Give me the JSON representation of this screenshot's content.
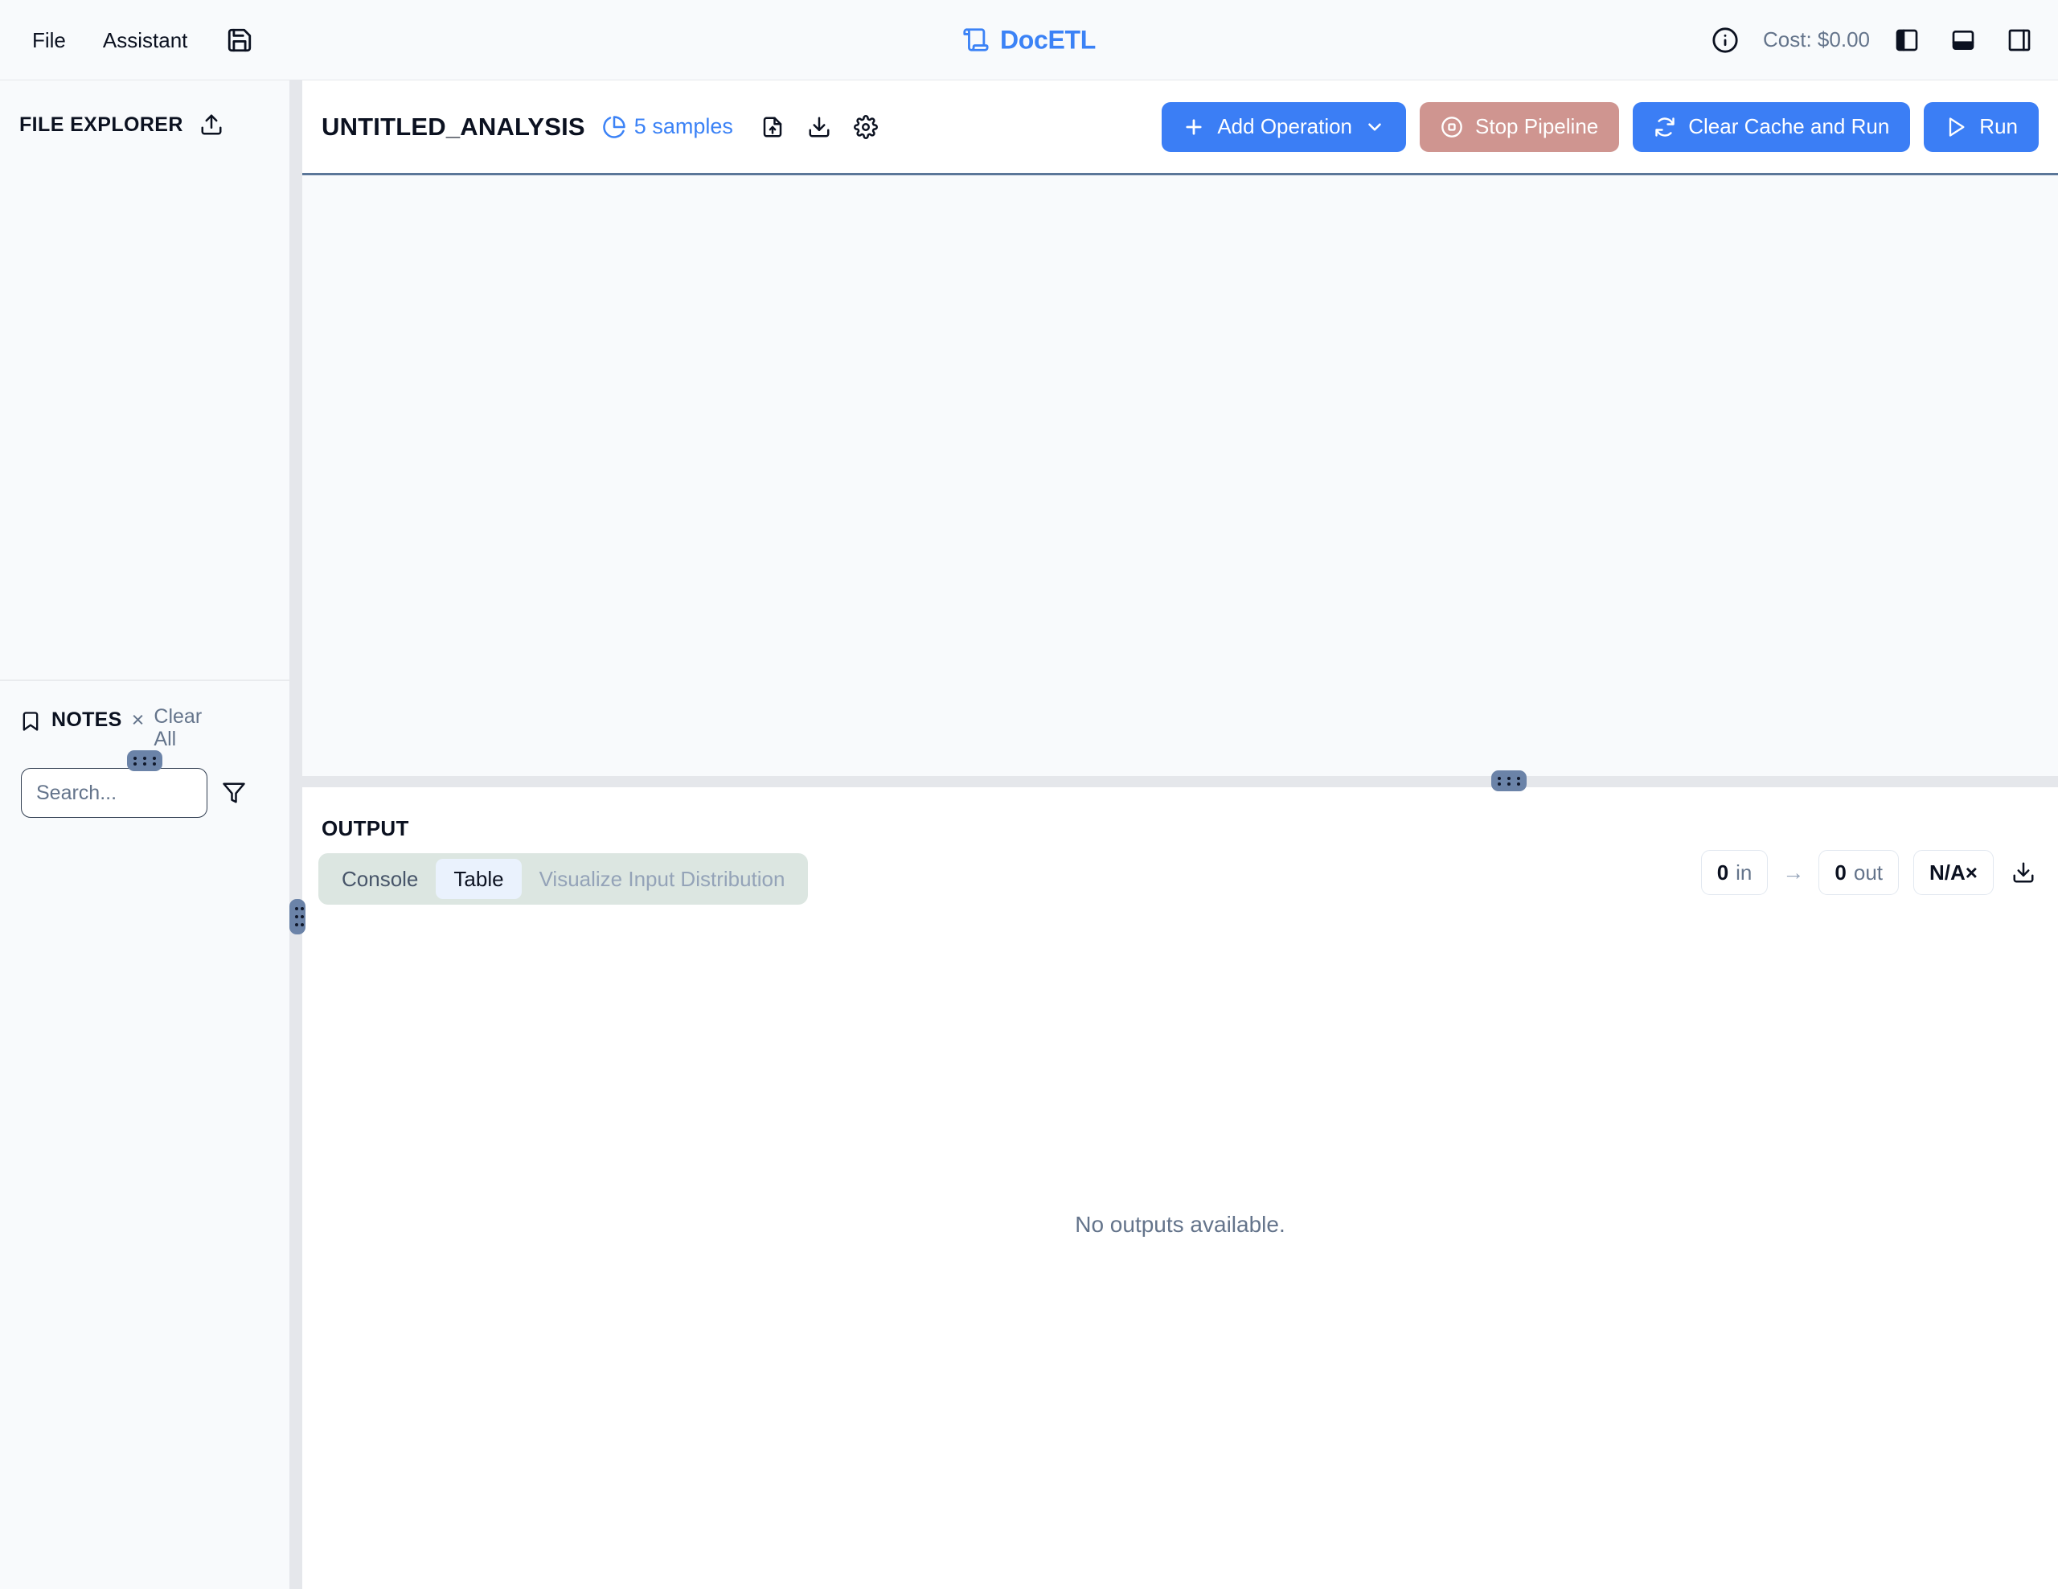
{
  "topbar": {
    "menu": [
      {
        "label": "File",
        "name": "menu-file"
      },
      {
        "label": "Assistant",
        "name": "menu-assistant"
      }
    ],
    "save_icon": "save-icon",
    "brand": "DocETL",
    "brand_icon": "scroll-icon",
    "brand_color": "#3b82f6",
    "info_icon": "info-icon",
    "cost_label": "Cost: $0.00",
    "panel_toggles": [
      {
        "name": "toggle-left-panel-icon"
      },
      {
        "name": "toggle-bottom-panel-icon"
      },
      {
        "name": "toggle-right-panel-icon"
      }
    ]
  },
  "file_explorer": {
    "title": "FILE EXPLORER",
    "upload_icon": "upload-icon"
  },
  "notes": {
    "title": "NOTES",
    "bookmark_icon": "bookmark-icon",
    "close_label": "×",
    "clear_all_label": "Clear All",
    "search_placeholder": "Search...",
    "search_value": "",
    "filter_icon": "filter-icon"
  },
  "pipeline": {
    "title": "UNTITLED_ANALYSIS",
    "samples_label": "5 samples",
    "samples_icon": "pie-chart-icon",
    "icons": [
      {
        "name": "file-upload-icon"
      },
      {
        "name": "download-icon"
      },
      {
        "name": "gear-icon"
      }
    ],
    "actions": {
      "add_operation": "Add Operation",
      "stop_pipeline": "Stop Pipeline",
      "clear_cache_and_run": "Clear Cache and Run",
      "run": "Run"
    },
    "accent_blue": "#3b7ef5",
    "stop_disabled_color": "#cf9590"
  },
  "output": {
    "title": "OUTPUT",
    "tabs": [
      {
        "label": "Console",
        "active": false,
        "muted": false
      },
      {
        "label": "Table",
        "active": true,
        "muted": false
      },
      {
        "label": "Visualize Input Distribution",
        "active": false,
        "muted": true
      }
    ],
    "stats": {
      "in_value": "0",
      "in_unit": "in",
      "arrow": "→",
      "out_value": "0",
      "out_unit": "out",
      "ratio": "N/A×"
    },
    "download_icon": "download-icon",
    "empty_message": "No outputs available."
  }
}
